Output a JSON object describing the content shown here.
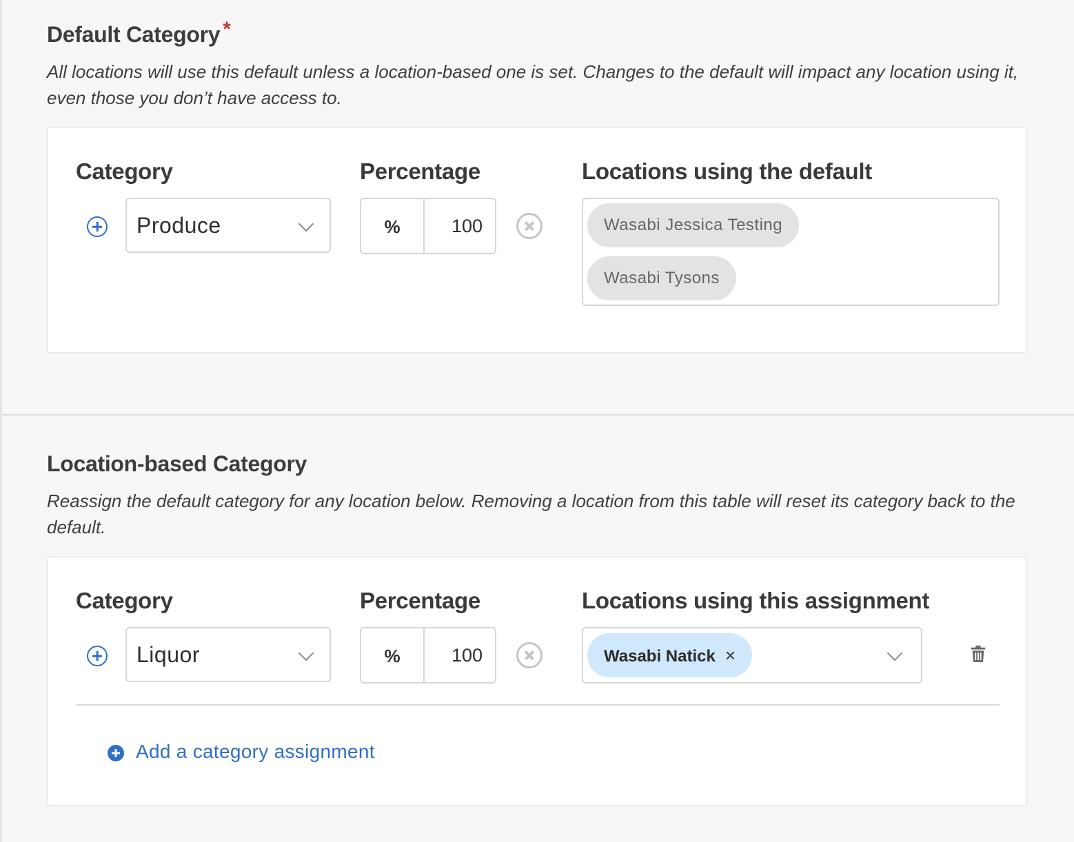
{
  "default_section": {
    "title": "Default Category",
    "required_mark": "*",
    "description": "All locations will use this default unless a location-based one is set. Changes to the default will impact any location using it, even those you don’t have access to.",
    "labels": {
      "category": "Category",
      "percentage": "Percentage",
      "locations": "Locations using the default"
    },
    "row": {
      "category": "Produce",
      "percent_symbol": "%",
      "percentage": "100",
      "locations": [
        "Wasabi Jessica Testing",
        "Wasabi Tysons"
      ]
    }
  },
  "location_section": {
    "title": "Location-based Category",
    "description": "Reassign the default category for any location below. Removing a location from this table will reset its category back to the default.",
    "labels": {
      "category": "Category",
      "percentage": "Percentage",
      "locations": "Locations using this assignment"
    },
    "row": {
      "category": "Liquor",
      "percent_symbol": "%",
      "percentage": "100",
      "locations": [
        "Wasabi Natick"
      ],
      "chip_remove": "×"
    },
    "add_link": "Add a category assignment"
  },
  "colors": {
    "accent": "#2f6fc7",
    "required": "#c0392b",
    "chip_selected": "#cfe8fb",
    "chip_static": "#e3e3e3"
  },
  "icons": [
    "add-circle-icon",
    "chevron-down-icon",
    "clear-circle-icon",
    "close-icon",
    "trash-icon",
    "add-filled-icon"
  ]
}
